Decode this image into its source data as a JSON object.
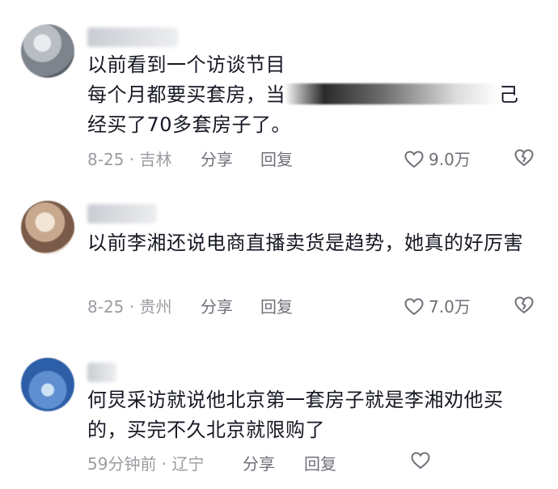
{
  "comments": [
    {
      "username": "",
      "line1": "以前看到一个访谈节目",
      "line2_prefix": "每个月都要买套房，当",
      "line2_suffix": "己",
      "line3": "经买了70多套房子了。",
      "date_location": "8-25 · 吉林",
      "share_label": "分享",
      "reply_label": "回复",
      "like_count": "9.0万",
      "icons": {
        "avatar": "avatar-image",
        "like": "heart-icon",
        "dislike": "broken-heart-icon"
      }
    },
    {
      "username": "",
      "text": "以前李湘还说电商直播卖货是趋势，她真的好厉害",
      "date_location": "8-25 · 贵州",
      "share_label": "分享",
      "reply_label": "回复",
      "like_count": "7.0万",
      "icons": {
        "avatar": "avatar-image",
        "like": "heart-icon",
        "dislike": "broken-heart-icon"
      }
    },
    {
      "username": "",
      "text": "何炅采访就说他北京第一套房子就是李湘劝他买的，买完不久北京就限购了",
      "date_location": "59分钟前 · 辽宁",
      "share_label": "分享",
      "reply_label": "回复",
      "like_count": "",
      "icons": {
        "avatar": "avatar-image",
        "like": "heart-icon"
      }
    }
  ],
  "colors": {
    "text": "#161823",
    "meta": "#9b9ca1",
    "action": "#6f7078"
  }
}
